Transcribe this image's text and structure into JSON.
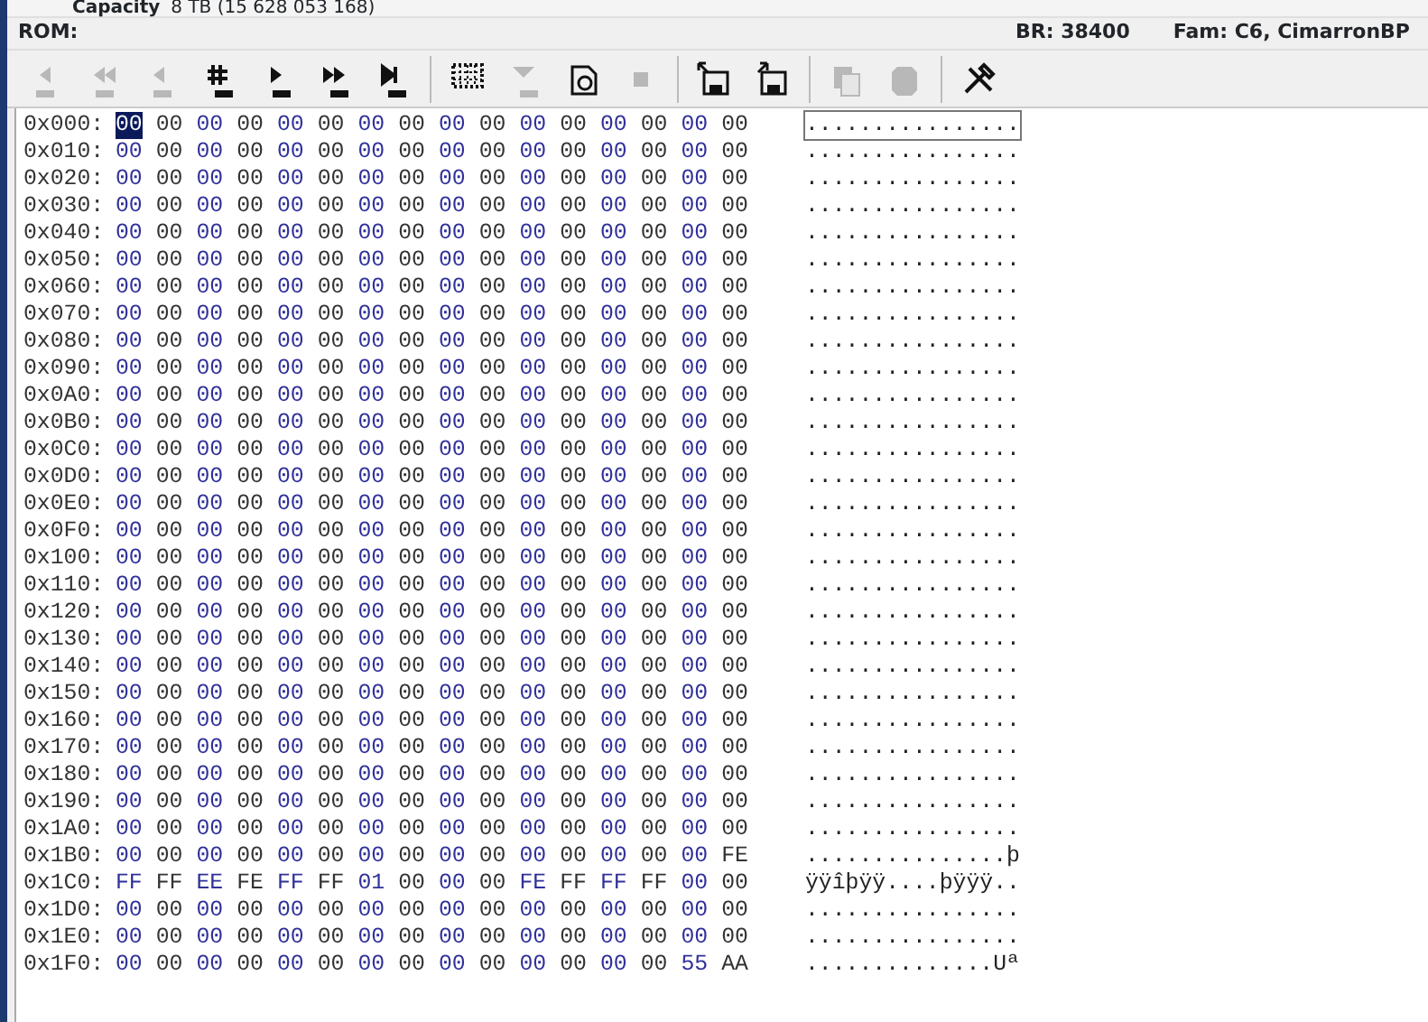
{
  "device_info": {
    "label": "Capacity",
    "value": "8 TB (15 628 053 168)"
  },
  "rom_bar": {
    "label": "ROM:",
    "baud_rate": "BR: 38400",
    "family": "Fam: C6, CimarronBP"
  },
  "toolbar": [
    {
      "kind": "first",
      "disabled": true
    },
    {
      "kind": "fast-back",
      "disabled": true
    },
    {
      "kind": "back",
      "disabled": true
    },
    {
      "kind": "goto",
      "disabled": false
    },
    {
      "kind": "forward",
      "disabled": false
    },
    {
      "kind": "fast-forward",
      "disabled": false
    },
    {
      "kind": "last",
      "disabled": false
    },
    {
      "kind": "separator"
    },
    {
      "kind": "grid",
      "disabled": false
    },
    {
      "kind": "dropdown",
      "disabled": true
    },
    {
      "kind": "device",
      "disabled": false
    },
    {
      "kind": "stop",
      "disabled": true
    },
    {
      "kind": "separator"
    },
    {
      "kind": "save-in",
      "disabled": false
    },
    {
      "kind": "save-out",
      "disabled": false
    },
    {
      "kind": "separator"
    },
    {
      "kind": "copy",
      "disabled": true
    },
    {
      "kind": "erase",
      "disabled": true
    },
    {
      "kind": "separator"
    },
    {
      "kind": "tools",
      "disabled": false
    }
  ],
  "hex_rows": [
    {
      "address": "0x000:",
      "bytes": "00 00 00 00 00 00 00 00 00 00 00 00 00 00 00 00",
      "ascii": "................",
      "caret": true
    },
    {
      "address": "0x010:",
      "bytes": "00 00 00 00 00 00 00 00 00 00 00 00 00 00 00 00",
      "ascii": "................",
      "caret": false
    },
    {
      "address": "0x020:",
      "bytes": "00 00 00 00 00 00 00 00 00 00 00 00 00 00 00 00",
      "ascii": "................",
      "caret": false
    },
    {
      "address": "0x030:",
      "bytes": "00 00 00 00 00 00 00 00 00 00 00 00 00 00 00 00",
      "ascii": "................",
      "caret": false
    },
    {
      "address": "0x040:",
      "bytes": "00 00 00 00 00 00 00 00 00 00 00 00 00 00 00 00",
      "ascii": "................",
      "caret": false
    },
    {
      "address": "0x050:",
      "bytes": "00 00 00 00 00 00 00 00 00 00 00 00 00 00 00 00",
      "ascii": "................",
      "caret": false
    },
    {
      "address": "0x060:",
      "bytes": "00 00 00 00 00 00 00 00 00 00 00 00 00 00 00 00",
      "ascii": "................",
      "caret": false
    },
    {
      "address": "0x070:",
      "bytes": "00 00 00 00 00 00 00 00 00 00 00 00 00 00 00 00",
      "ascii": "................",
      "caret": false
    },
    {
      "address": "0x080:",
      "bytes": "00 00 00 00 00 00 00 00 00 00 00 00 00 00 00 00",
      "ascii": "................",
      "caret": false
    },
    {
      "address": "0x090:",
      "bytes": "00 00 00 00 00 00 00 00 00 00 00 00 00 00 00 00",
      "ascii": "................",
      "caret": false
    },
    {
      "address": "0x0A0:",
      "bytes": "00 00 00 00 00 00 00 00 00 00 00 00 00 00 00 00",
      "ascii": "................",
      "caret": false
    },
    {
      "address": "0x0B0:",
      "bytes": "00 00 00 00 00 00 00 00 00 00 00 00 00 00 00 00",
      "ascii": "................",
      "caret": false
    },
    {
      "address": "0x0C0:",
      "bytes": "00 00 00 00 00 00 00 00 00 00 00 00 00 00 00 00",
      "ascii": "................",
      "caret": false
    },
    {
      "address": "0x0D0:",
      "bytes": "00 00 00 00 00 00 00 00 00 00 00 00 00 00 00 00",
      "ascii": "................",
      "caret": false
    },
    {
      "address": "0x0E0:",
      "bytes": "00 00 00 00 00 00 00 00 00 00 00 00 00 00 00 00",
      "ascii": "................",
      "caret": false
    },
    {
      "address": "0x0F0:",
      "bytes": "00 00 00 00 00 00 00 00 00 00 00 00 00 00 00 00",
      "ascii": "................",
      "caret": false
    },
    {
      "address": "0x100:",
      "bytes": "00 00 00 00 00 00 00 00 00 00 00 00 00 00 00 00",
      "ascii": "................",
      "caret": false
    },
    {
      "address": "0x110:",
      "bytes": "00 00 00 00 00 00 00 00 00 00 00 00 00 00 00 00",
      "ascii": "................",
      "caret": false
    },
    {
      "address": "0x120:",
      "bytes": "00 00 00 00 00 00 00 00 00 00 00 00 00 00 00 00",
      "ascii": "................",
      "caret": false
    },
    {
      "address": "0x130:",
      "bytes": "00 00 00 00 00 00 00 00 00 00 00 00 00 00 00 00",
      "ascii": "................",
      "caret": false
    },
    {
      "address": "0x140:",
      "bytes": "00 00 00 00 00 00 00 00 00 00 00 00 00 00 00 00",
      "ascii": "................",
      "caret": false
    },
    {
      "address": "0x150:",
      "bytes": "00 00 00 00 00 00 00 00 00 00 00 00 00 00 00 00",
      "ascii": "................",
      "caret": false
    },
    {
      "address": "0x160:",
      "bytes": "00 00 00 00 00 00 00 00 00 00 00 00 00 00 00 00",
      "ascii": "................",
      "caret": false
    },
    {
      "address": "0x170:",
      "bytes": "00 00 00 00 00 00 00 00 00 00 00 00 00 00 00 00",
      "ascii": "................",
      "caret": false
    },
    {
      "address": "0x180:",
      "bytes": "00 00 00 00 00 00 00 00 00 00 00 00 00 00 00 00",
      "ascii": "................",
      "caret": false
    },
    {
      "address": "0x190:",
      "bytes": "00 00 00 00 00 00 00 00 00 00 00 00 00 00 00 00",
      "ascii": "................",
      "caret": false
    },
    {
      "address": "0x1A0:",
      "bytes": "00 00 00 00 00 00 00 00 00 00 00 00 00 00 00 00",
      "ascii": "................",
      "caret": false
    },
    {
      "address": "0x1B0:",
      "bytes": "00 00 00 00 00 00 00 00 00 00 00 00 00 00 00 FE",
      "ascii": "...............þ",
      "caret": false
    },
    {
      "address": "0x1C0:",
      "bytes": "FF FF EE FE FF FF 01 00 00 00 FE FF FF FF 00 00",
      "ascii": "ÿÿîþÿÿ....þÿÿÿ..",
      "caret": false
    },
    {
      "address": "0x1D0:",
      "bytes": "00 00 00 00 00 00 00 00 00 00 00 00 00 00 00 00",
      "ascii": "................",
      "caret": false
    },
    {
      "address": "0x1E0:",
      "bytes": "00 00 00 00 00 00 00 00 00 00 00 00 00 00 00 00",
      "ascii": "................",
      "caret": false
    },
    {
      "address": "0x1F0:",
      "bytes": "00 00 00 00 00 00 00 00 00 00 00 00 00 00 55 AA",
      "ascii": "..............Uª",
      "caret": false
    }
  ]
}
